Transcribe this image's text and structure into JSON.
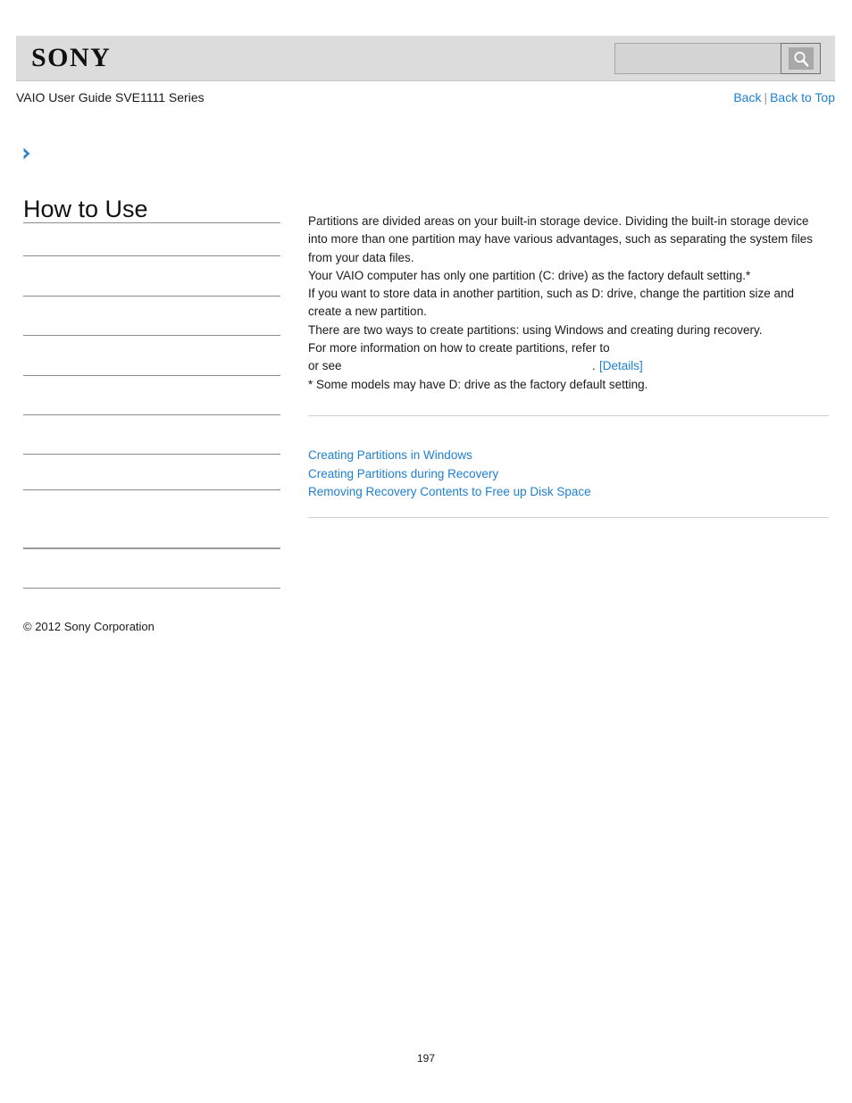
{
  "header": {
    "logo_text": "SONY",
    "search": {
      "value": "",
      "placeholder": "",
      "icon": "search-icon"
    }
  },
  "subheader": {
    "guide_title": "VAIO User Guide SVE1111 Series",
    "nav": {
      "back_label": "Back",
      "separator": "|",
      "back_to_top_label": "Back to Top"
    }
  },
  "sidebar": {
    "expand_icon": "chevron-right-icon",
    "heading": "How to Use",
    "items": [
      {
        "label": ""
      },
      {
        "label": ""
      },
      {
        "label": ""
      },
      {
        "label": ""
      },
      {
        "label": ""
      },
      {
        "label": ""
      },
      {
        "label": ""
      },
      {
        "label": ""
      },
      {
        "label": ""
      }
    ],
    "copyright": "© 2012 Sony Corporation"
  },
  "content": {
    "paragraphs": [
      "Partitions are divided areas on your built-in storage device. Dividing the built-in storage device into more than one partition may have various advantages, such as separating the system files from your data files.",
      "Your VAIO computer has only one partition (C: drive) as the factory default setting.*",
      "If you want to store data in another partition, such as D: drive, change the partition size and create a new partition.",
      "There are two ways to create partitions: using Windows and creating during recovery.",
      "For more information on how to create partitions, refer to"
    ],
    "details_line": {
      "prefix": "or see",
      "period": ".",
      "details_label": "[Details]"
    },
    "footnote": "* Some models may have D: drive as the factory default setting.",
    "related_links": [
      "Creating Partitions in Windows",
      "Creating Partitions during Recovery",
      "Removing Recovery Contents to Free up Disk Space"
    ]
  },
  "footer": {
    "page_number": "197"
  },
  "colors": {
    "link": "#1f7fd0",
    "header_bg": "#dcdcdc",
    "rule": "#d0d0d0",
    "menu_rule": "#8c8c8c"
  }
}
